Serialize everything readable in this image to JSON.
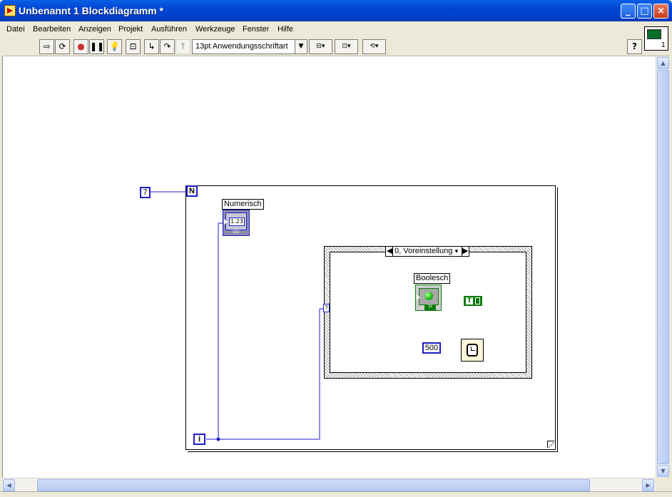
{
  "window": {
    "title": "Unbenannt 1 Blockdiagramm *",
    "min": "_",
    "max": "□",
    "close": "×"
  },
  "menu": [
    "Datei",
    "Bearbeiten",
    "Anzeigen",
    "Projekt",
    "Ausführen",
    "Werkzeuge",
    "Fenster",
    "Hilfe"
  ],
  "toolbar": {
    "font": "13pt Anwendungsschriftart",
    "help": "?"
  },
  "vi_icon_number": "1",
  "diagram": {
    "count_constant": "7",
    "count_terminal": "N",
    "iteration_terminal": "i",
    "numeric_label": "Numerisch",
    "numeric_display": "1.23",
    "numeric_type": "I32",
    "case_selector": "0, Voreinstellung",
    "boolean_label": "Boolesch",
    "boolean_type": "TF",
    "true_constant": "T",
    "wait_constant": "500",
    "selector_terminal": "?"
  }
}
